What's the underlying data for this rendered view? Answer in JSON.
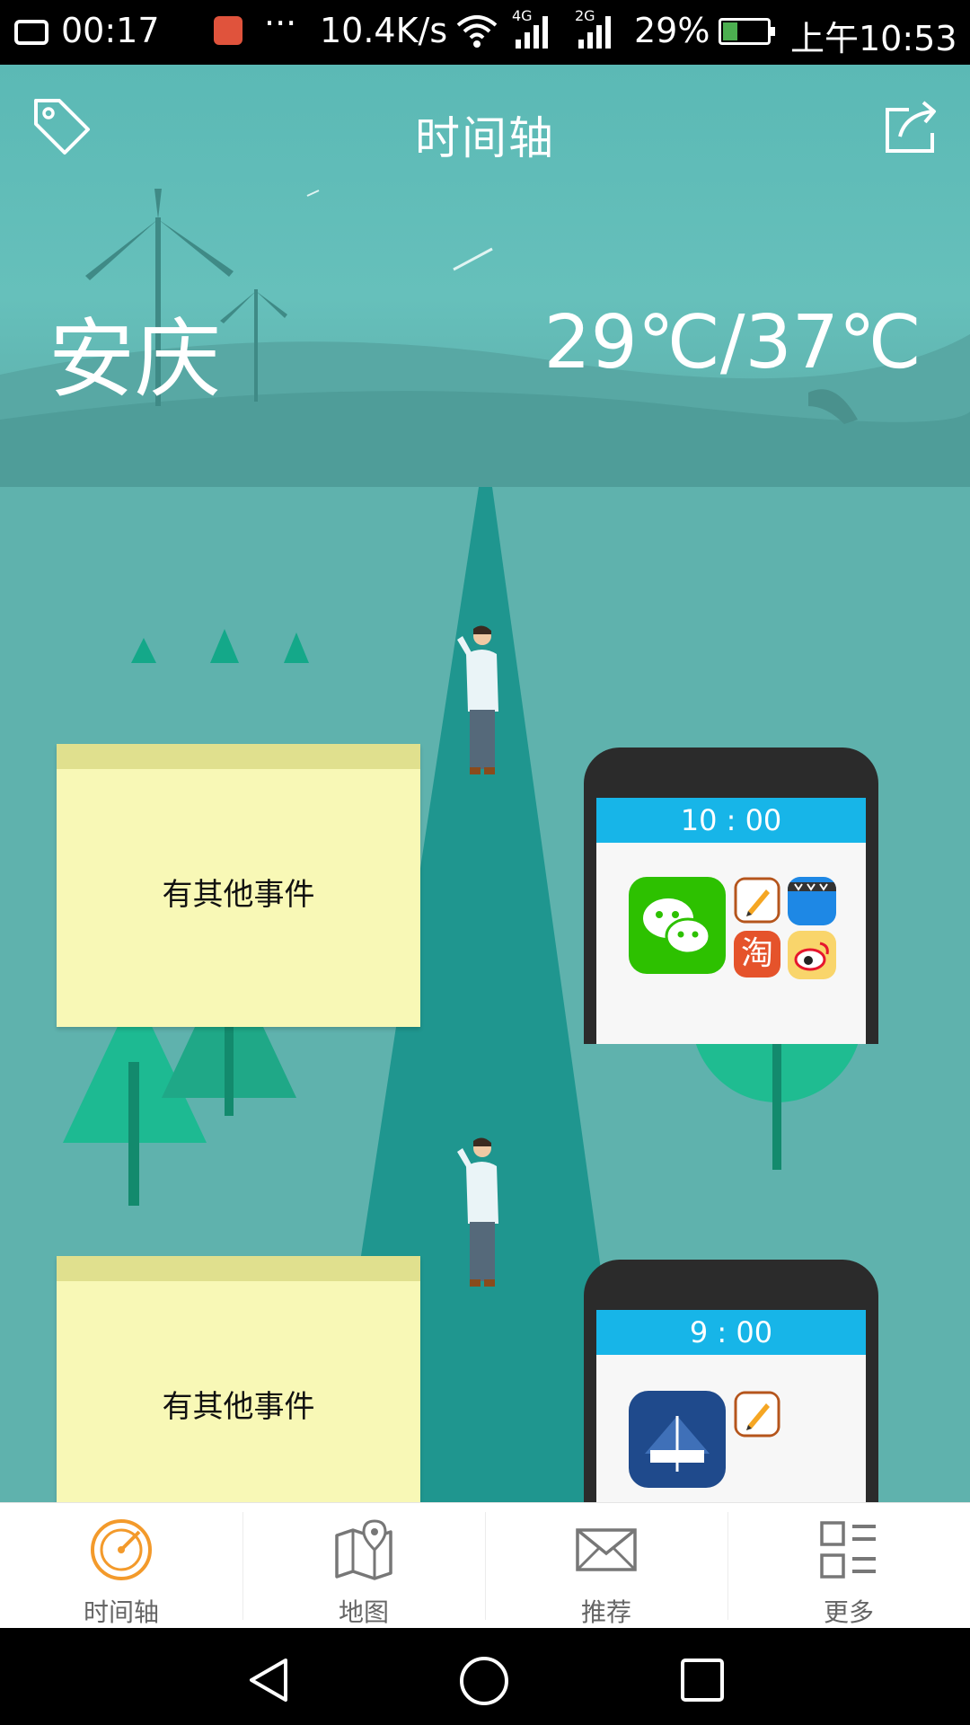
{
  "status_bar": {
    "clock": "00:17",
    "dots": "···",
    "speed": "10.4K/s",
    "net1": "4G",
    "net2": "2G",
    "battery": "29%",
    "time": "上午10:53"
  },
  "header": {
    "title": "时间轴",
    "city": "安庆",
    "temperature": "29℃/37℃"
  },
  "timeline": [
    {
      "note": "有其他事件",
      "time": "10 : 00",
      "apps": [
        "wechat-icon",
        "notes-icon",
        "video-icon",
        "taobao-icon",
        "weibo-icon"
      ],
      "taobao_label": "淘"
    },
    {
      "note": "有其他事件",
      "time": "9 : 00",
      "apps": [
        "game-icon",
        "notes-icon"
      ]
    }
  ],
  "bottom_nav": {
    "items": [
      {
        "label": "时间轴",
        "icon": "compass-icon",
        "active": true
      },
      {
        "label": "地图",
        "icon": "map-icon",
        "active": false
      },
      {
        "label": "推荐",
        "icon": "mail-icon",
        "active": false
      },
      {
        "label": "更多",
        "icon": "menu-icon",
        "active": false
      }
    ]
  },
  "colors": {
    "accent": "#f39a2b",
    "scene": "#5fb2ad",
    "note": "#f8f8b6",
    "phone_header": "#17b5e8"
  }
}
